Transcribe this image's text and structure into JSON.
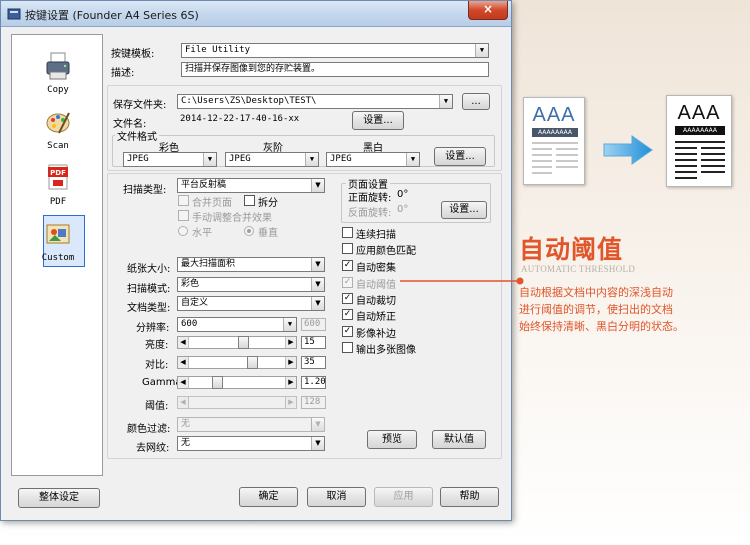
{
  "window": {
    "title": "按键设置 (Founder A4 Series 6S)",
    "close_glyph": "×"
  },
  "left_panel": {
    "items": [
      {
        "label": "Copy",
        "icon": "printer-icon"
      },
      {
        "label": "Scan",
        "icon": "palette-icon"
      },
      {
        "label": "PDF",
        "icon": "pdf-icon"
      },
      {
        "label": "Custom",
        "icon": "custom-icon"
      }
    ],
    "selected": "Custom"
  },
  "top": {
    "template_label": "按键模板:",
    "template_value": "File Utility",
    "desc_label": "描述:",
    "desc_value": "扫描并保存图像到您的存贮装置。"
  },
  "save": {
    "folder_label": "保存文件夹:",
    "folder_value": "C:\\Users\\ZS\\Desktop\\TEST\\",
    "browse_label": "...",
    "filename_label": "文件名:",
    "filename_value": "2014-12-22-17-40-16-xx",
    "filename_settings": "设置...",
    "format_group": "文件格式",
    "format_cols": [
      {
        "label": "彩色",
        "value": "JPEG"
      },
      {
        "label": "灰阶",
        "value": "JPEG"
      },
      {
        "label": "黑白",
        "value": "JPEG"
      }
    ],
    "format_settings": "设置..."
  },
  "scan": {
    "type_label": "扫描类型:",
    "type_value": "平台反射稿",
    "merge_label": "合并页面",
    "split_label": "拆分",
    "manual_label": "手动调整合并效果",
    "horizontal_label": "水平",
    "vertical_label": "垂直"
  },
  "page_setup": {
    "group": "页面设置",
    "front_label": "正面旋转:",
    "front_value": "0°",
    "back_label": "反面旋转:",
    "back_value": "0°",
    "settings": "设置..."
  },
  "options": [
    {
      "label": "连续扫描",
      "checked": false,
      "disabled": false
    },
    {
      "label": "应用颜色匹配",
      "checked": false,
      "disabled": false
    },
    {
      "label": "自动密集",
      "checked": true,
      "disabled": false
    },
    {
      "label": "自动阈值",
      "checked": true,
      "disabled": true
    },
    {
      "label": "自动裁切",
      "checked": true,
      "disabled": false
    },
    {
      "label": "自动矫正",
      "checked": true,
      "disabled": false
    },
    {
      "label": "影像补边",
      "checked": true,
      "disabled": false
    },
    {
      "label": "输出多张图像",
      "checked": false,
      "disabled": false
    }
  ],
  "image": {
    "paper_label": "纸张大小:",
    "paper_value": "最大扫描面积",
    "mode_label": "扫描模式:",
    "mode_value": "彩色",
    "doctype_label": "文档类型:",
    "doctype_value": "自定义",
    "dpi_label": "分辨率:",
    "dpi_value": "600",
    "dpi_value2": "600",
    "brightness_label": "亮度:",
    "brightness_value": "15",
    "contrast_label": "对比:",
    "contrast_value": "35",
    "gamma_label": "Gamma:",
    "gamma_value": "1.20",
    "threshold_label": "阈值:",
    "threshold_value": "128",
    "dropout_label": "颜色过滤:",
    "dropout_value": "无",
    "descreen_label": "去网纹:",
    "descreen_value": "无"
  },
  "buttons": {
    "preview": "预览",
    "default": "默认值",
    "global": "整体设定",
    "ok": "确定",
    "cancel": "取消",
    "apply": "应用",
    "help": "帮助"
  },
  "feature": {
    "doc_text": "AAA",
    "doc_bar_text": "AAAAAAAA",
    "title": "自动阈值",
    "subtitle": "AUTOMATIC THRESHOLD",
    "desc_lines": [
      "自动根据文档中内容的深浅自动",
      "进行阈值的调节，使扫出的文档",
      "始终保持清晰、黑白分明的状态。"
    ],
    "accent_color": "#e0552a",
    "arrow_color": "#3aa3e0"
  }
}
